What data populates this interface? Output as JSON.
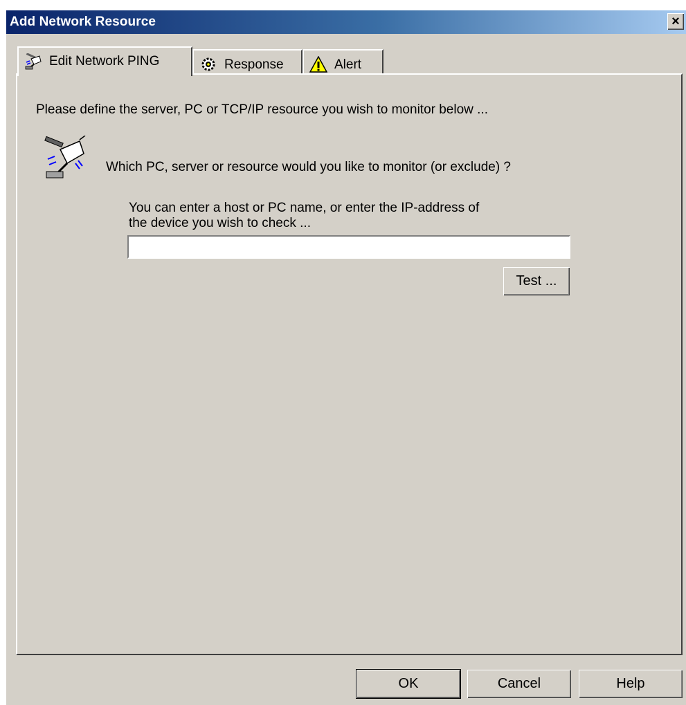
{
  "window": {
    "title": "Add Network Resource",
    "close_glyph": "×"
  },
  "tabs": [
    {
      "label": "Edit Network PING",
      "icon": "network-ping-icon",
      "active": true
    },
    {
      "label": "Response",
      "icon": "gear-icon",
      "active": false
    },
    {
      "label": "Alert",
      "icon": "warning-icon",
      "active": false
    }
  ],
  "content": {
    "intro": "Please define the server, PC or TCP/IP resource you wish to monitor below ...",
    "question": "Which PC, server or resource would you like to monitor (or exclude) ?",
    "hint_line1": "You can enter a host or PC name, or enter the IP-address of",
    "hint_line2": "the device you wish to check ...",
    "host_value": "",
    "test_label": "Test ..."
  },
  "buttons": {
    "ok": "OK",
    "cancel": "Cancel",
    "help": "Help"
  },
  "colors": {
    "face": "#d4d0c8",
    "title_start": "#0a246a",
    "title_end": "#a6caf0",
    "warning_yellow": "#ffff00"
  }
}
